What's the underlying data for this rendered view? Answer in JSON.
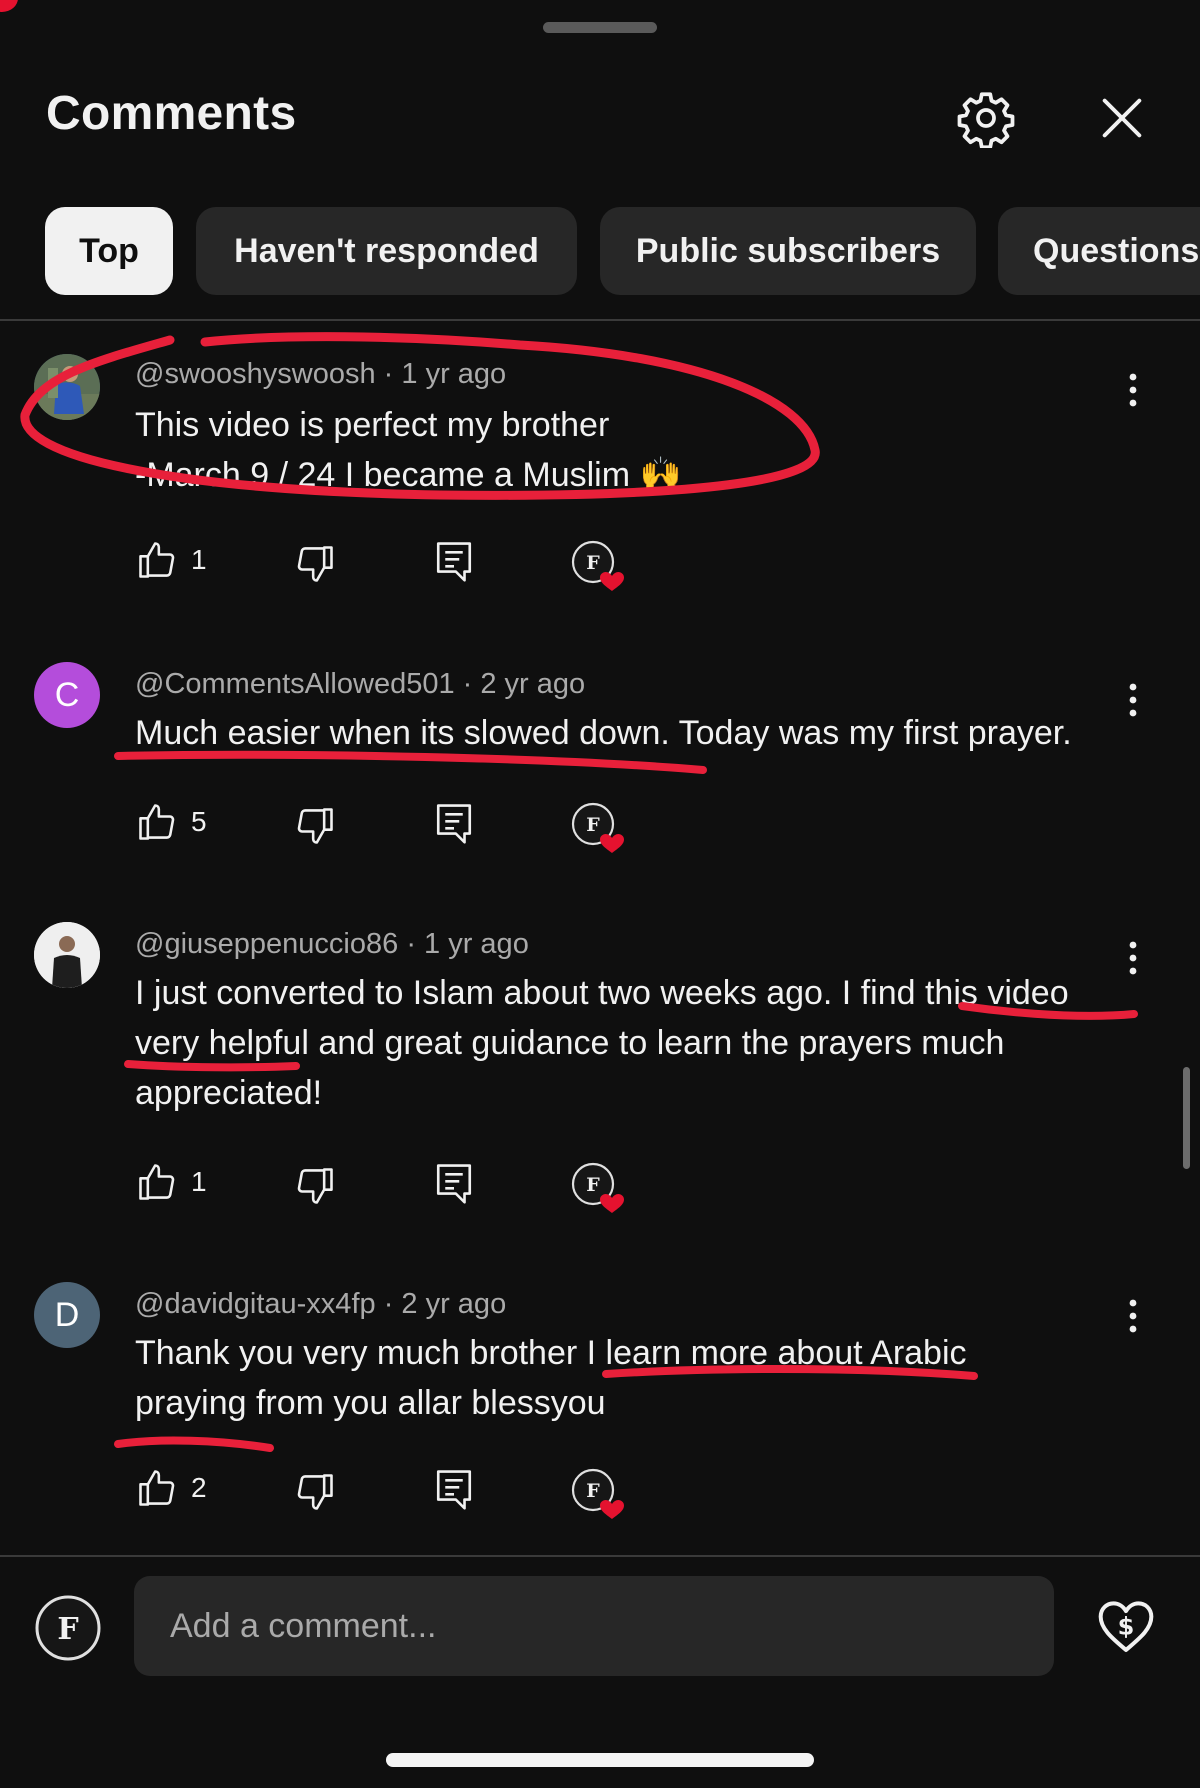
{
  "header": {
    "title": "Comments"
  },
  "filters": [
    {
      "label": "Top",
      "active": true
    },
    {
      "label": "Haven't responded",
      "active": false
    },
    {
      "label": "Public subscribers",
      "active": false
    },
    {
      "label": "Questions",
      "active": false
    }
  ],
  "comments": [
    {
      "author": "@swooshyswoosh",
      "time": "1 yr ago",
      "lines": [
        "This video is perfect my brother",
        "-March 9 / 24 I became a Muslim 🙌"
      ],
      "likes": "1",
      "avatar": {
        "type": "photo",
        "color": "#3b5a7a"
      }
    },
    {
      "author": "@CommentsAllowed501",
      "time": "2 yr ago",
      "lines": [
        "Much easier when its slowed down. Today was my first prayer."
      ],
      "likes": "5",
      "avatar": {
        "type": "letter",
        "letter": "C",
        "color": "#b44ddb"
      }
    },
    {
      "author": "@giuseppenuccio86",
      "time": "1 yr ago",
      "lines": [
        "I just converted to Islam about two weeks ago. I find this video",
        "very helpful and great guidance to learn the prayers much",
        "appreciated!"
      ],
      "likes": "1",
      "avatar": {
        "type": "photo",
        "color": "#e8e8e8"
      }
    },
    {
      "author": "@davidgitau-xx4fp",
      "time": "2 yr ago",
      "lines": [
        "Thank you very much brother I learn more about Arabic",
        "praying from you allar  blessyou"
      ],
      "likes": "2",
      "avatar": {
        "type": "letter",
        "letter": "D",
        "color": "#4d6476"
      }
    }
  ],
  "composer": {
    "placeholder": "Add a comment..."
  },
  "colors": {
    "background": "#0f0f0f",
    "chip": "#272727",
    "annotation": "#e8203a",
    "heart": "#e5122f"
  }
}
